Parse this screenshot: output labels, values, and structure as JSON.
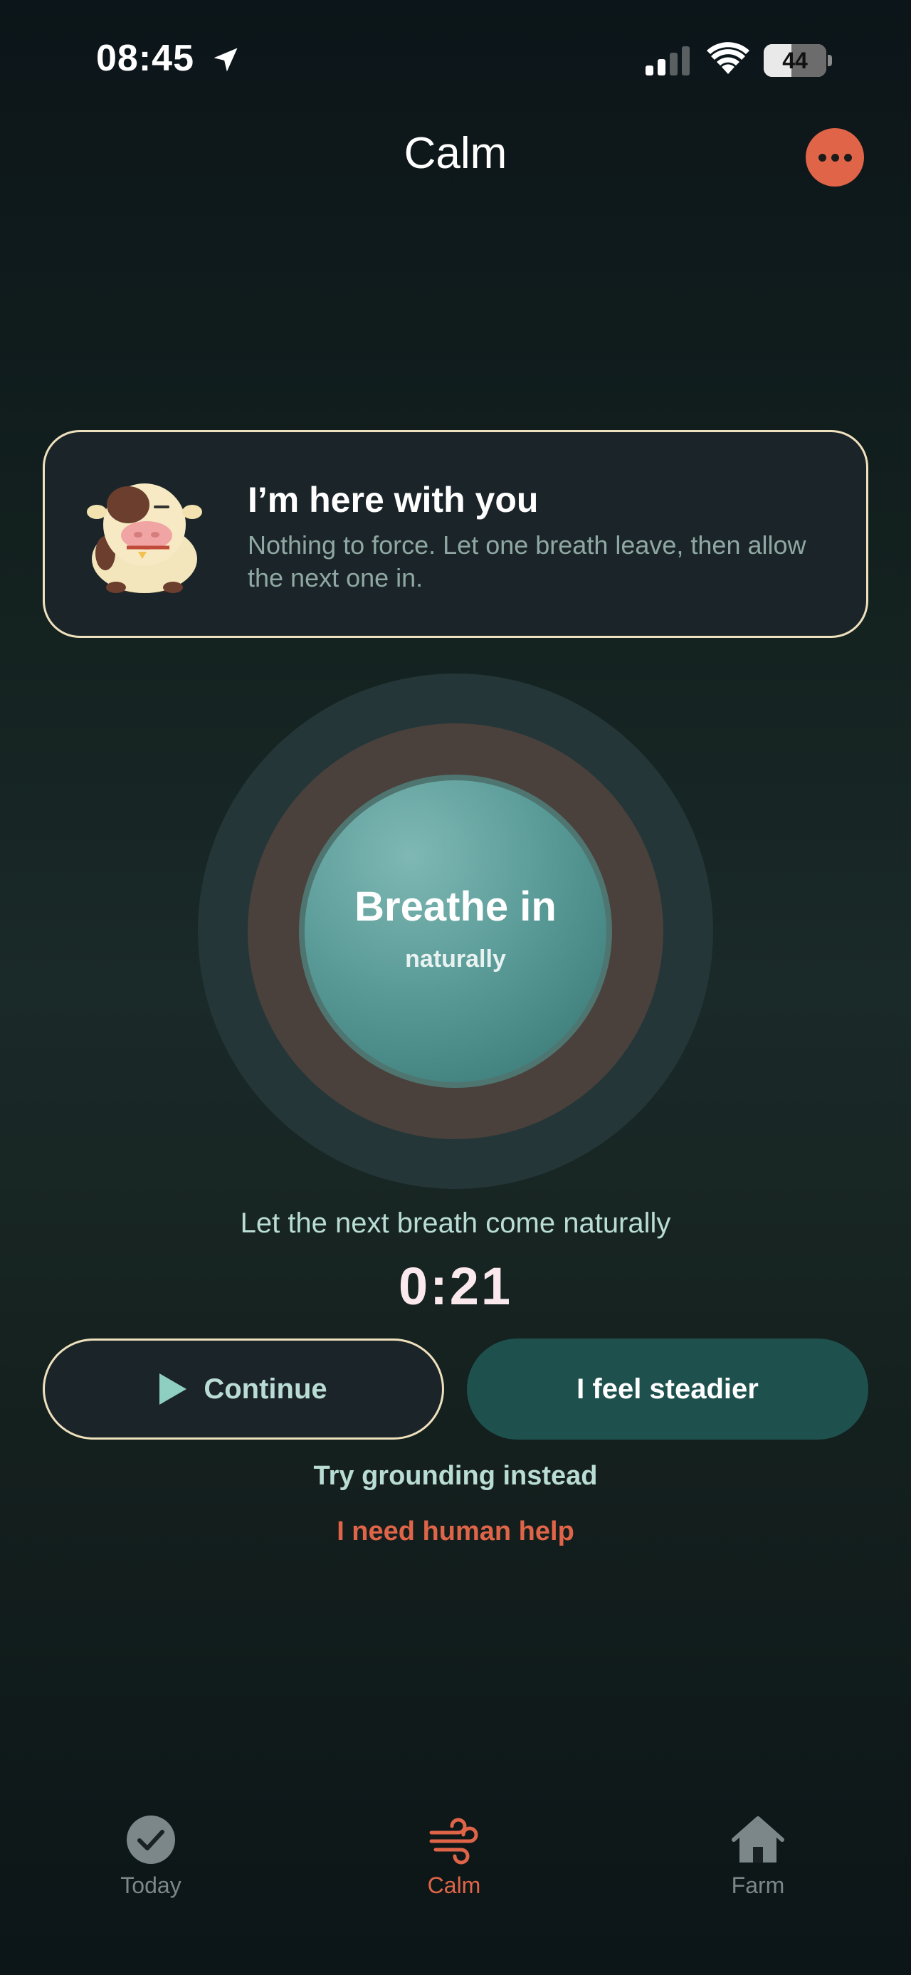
{
  "status_bar": {
    "time": "08:45",
    "battery_percent": "44",
    "battery_level": 0.44
  },
  "header": {
    "title": "Calm"
  },
  "companion_card": {
    "title": "I’m here with you",
    "body": "Nothing to force. Let one breath leave, then allow the next one in."
  },
  "breath": {
    "label": "Breathe in",
    "sub": "naturally"
  },
  "prompt": "Let the next breath come naturally",
  "timer": "0:21",
  "actions": {
    "continue_label": "Continue",
    "steadier_label": "I feel steadier",
    "grounding_label": "Try grounding instead",
    "help_label": "I need human help"
  },
  "tabs": [
    {
      "label": "Today",
      "icon": "check-circle-icon",
      "active": false
    },
    {
      "label": "Calm",
      "icon": "wind-icon",
      "active": true
    },
    {
      "label": "Farm",
      "icon": "house-icon",
      "active": false
    }
  ],
  "colors": {
    "accent": "#e06548",
    "teal": "#1e514e",
    "card_border": "#efe1bd",
    "mint_text": "#b9dcd4",
    "inactive_tab": "#7c878a"
  }
}
